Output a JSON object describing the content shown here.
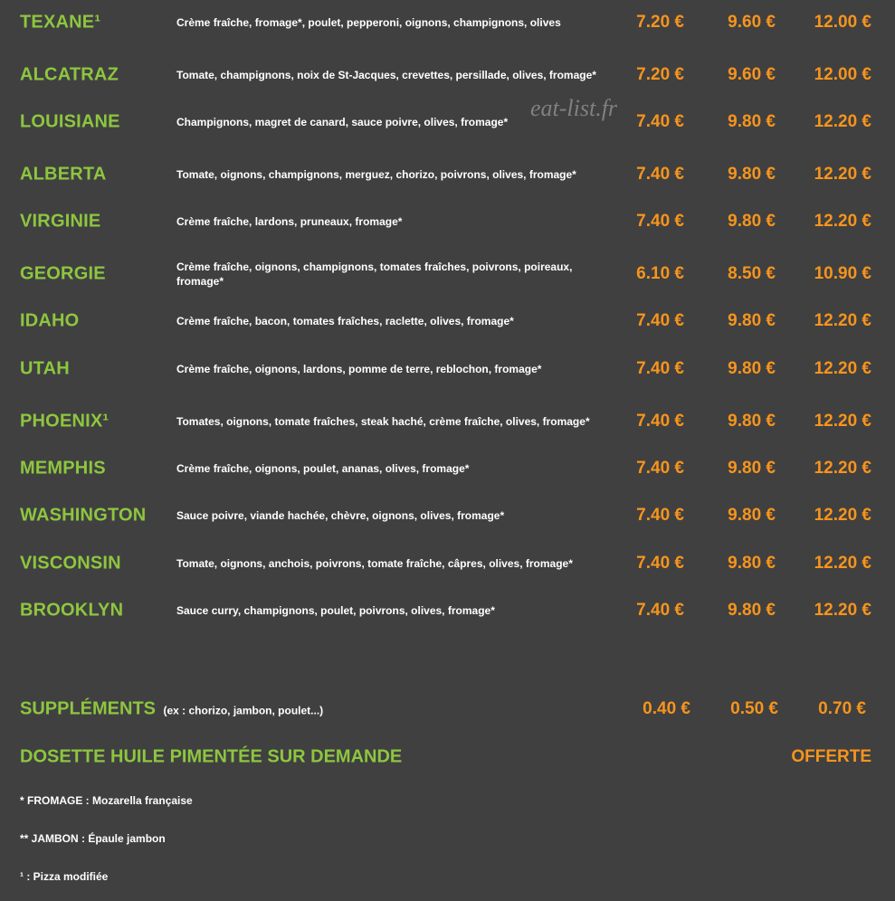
{
  "pizzas": [
    {
      "name": "TEXANE¹",
      "desc": "Crème fraîche, fromage*, poulet, pepperoni, oignons, champignons, olives",
      "p1": "7.20 €",
      "p2": "9.60 €",
      "p3": "12.00 €"
    },
    {
      "name": "ALCATRAZ",
      "desc": "Tomate, champignons, noix de St-Jacques, crevettes, persillade, olives, fromage*",
      "p1": "7.20 €",
      "p2": "9.60 €",
      "p3": "12.00 €"
    },
    {
      "name": "LOUISIANE",
      "desc": "Champignons, magret de canard, sauce poivre, olives, fromage*",
      "p1": "7.40 €",
      "p2": "9.80 €",
      "p3": "12.20 €"
    },
    {
      "name": "ALBERTA",
      "desc": "Tomate, oignons, champignons, merguez, chorizo, poivrons, olives, fromage*",
      "p1": "7.40 €",
      "p2": "9.80 €",
      "p3": "12.20 €"
    },
    {
      "name": "VIRGINIE",
      "desc": "Crème fraîche, lardons, pruneaux, fromage*",
      "p1": "7.40 €",
      "p2": "9.80 €",
      "p3": "12.20 €"
    },
    {
      "name": "GEORGIE",
      "desc": "Crème fraîche, oignons, champignons, tomates fraîches, poivrons, poireaux, fromage*",
      "p1": "6.10 €",
      "p2": "8.50 €",
      "p3": "10.90 €"
    },
    {
      "name": "IDAHO",
      "desc": "Crème fraîche, bacon, tomates fraîches, raclette, olives, fromage*",
      "p1": "7.40 €",
      "p2": "9.80 €",
      "p3": "12.20 €"
    },
    {
      "name": "UTAH",
      "desc": "Crème fraîche, oignons, lardons, pomme de terre, reblochon, fromage*",
      "p1": "7.40 €",
      "p2": "9.80 €",
      "p3": "12.20 €"
    },
    {
      "name": "PHOENIX¹",
      "desc": "Tomates, oignons, tomate fraîches, steak haché, crème fraîche, olives, fromage*",
      "p1": "7.40 €",
      "p2": "9.80 €",
      "p3": "12.20 €"
    },
    {
      "name": "MEMPHIS",
      "desc": "Crème fraîche, oignons, poulet, ananas, olives, fromage*",
      "p1": "7.40 €",
      "p2": "9.80 €",
      "p3": "12.20 €"
    },
    {
      "name": "WASHINGTON",
      "desc": "Sauce poivre, viande hachée, chèvre, oignons, olives, fromage*",
      "p1": "7.40 €",
      "p2": "9.80 €",
      "p3": "12.20 €"
    },
    {
      "name": "VISCONSIN",
      "desc": "Tomate, oignons, anchois, poivrons, tomate fraîche, câpres, olives, fromage*",
      "p1": "7.40 €",
      "p2": "9.80 €",
      "p3": "12.20 €"
    },
    {
      "name": "BROOKLYN",
      "desc": "Sauce curry, champignons, poulet, poivrons, olives, fromage*",
      "p1": "7.40 €",
      "p2": "9.80 €",
      "p3": "12.20 €"
    }
  ],
  "supplements": {
    "title": "SUPPLÉMENTS",
    "subtitle": "(ex : chorizo, jambon, poulet...)",
    "p1": "0.40 €",
    "p2": "0.50 €",
    "p3": "0.70 €"
  },
  "oil": {
    "title": "DOSETTE HUILE PIMENTÉE SUR DEMANDE",
    "price": "OFFERTE"
  },
  "notes": {
    "fromage": "* FROMAGE : Mozarella française",
    "jambon": "** JAMBON : Épaule jambon",
    "modifiee": "¹ : Pizza modifiée"
  },
  "watermark": "eat-list.fr",
  "colors": {
    "background": "#404040",
    "name": "#8dc63f",
    "price": "#f7941d",
    "text": "#ffffff"
  }
}
